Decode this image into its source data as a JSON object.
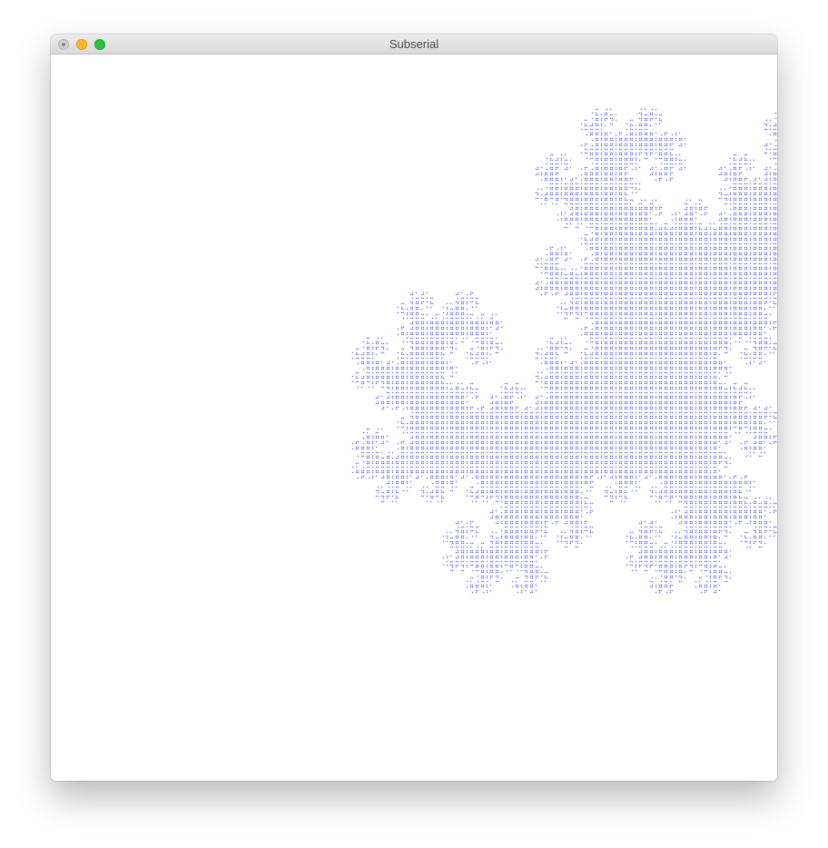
{
  "window": {
    "title": "Subserial"
  },
  "canvas": {
    "plot_color": "#0000cc",
    "background": "#ffffff"
  }
}
